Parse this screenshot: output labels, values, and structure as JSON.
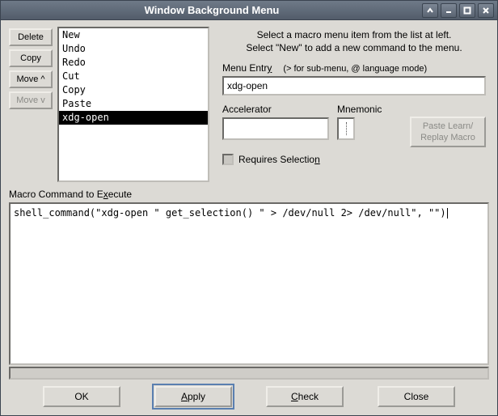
{
  "window": {
    "title": "Window Background Menu"
  },
  "buttons": {
    "delete": "Delete",
    "copy": "Copy",
    "move_up": "Move ^",
    "move_down": "Move v"
  },
  "macros": [
    "New",
    "Undo",
    "Redo",
    "Cut",
    "Copy",
    "Paste",
    "xdg-open"
  ],
  "selected_macro_index": 6,
  "instructions": {
    "line1": "Select a macro menu item from the list at left.",
    "line2": "Select \"New\" to add a new command to the menu."
  },
  "menu_entry": {
    "label_pre": "Menu Entr",
    "label_u": "y",
    "sub": "(> for sub-menu, @ language mode)",
    "value": "xdg-open"
  },
  "accelerator": {
    "label": "Accelerator",
    "value": ""
  },
  "mnemonic": {
    "label": "Mnemonic",
    "value": ""
  },
  "paste_learn": {
    "l1": "Paste Learn/",
    "l2": "Replay Macro"
  },
  "requires": {
    "label_pre": "Requires Selectio",
    "label_u": "n",
    "checked": false
  },
  "cmd": {
    "label_pre": "Macro Command to E",
    "label_u": "x",
    "label_post": "ecute",
    "value": "shell_command(\"xdg-open \" get_selection() \" > /dev/null 2> /dev/null\", \"\")"
  },
  "bottom": {
    "ok": "OK",
    "apply_u": "A",
    "apply_post": "pply",
    "check_u": "C",
    "check_post": "heck",
    "close": "Close"
  }
}
